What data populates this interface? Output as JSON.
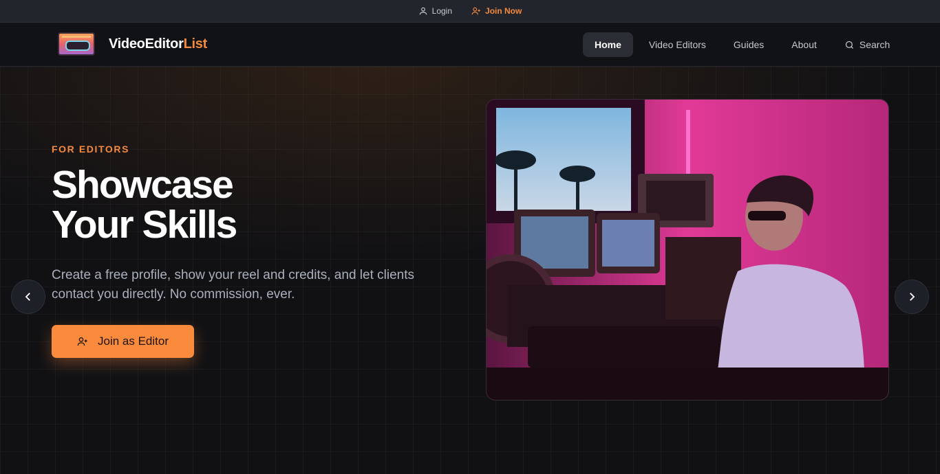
{
  "topbar": {
    "login": "Login",
    "join": "Join Now"
  },
  "brand": {
    "name_main": "VideoEditor",
    "name_accent": "List"
  },
  "nav": {
    "items": [
      "Home",
      "Video Editors",
      "Guides",
      "About"
    ],
    "search": "Search",
    "active": "Home"
  },
  "hero": {
    "eyebrow": "FOR EDITORS",
    "title_line1": "Showcase",
    "title_line2": "Your Skills",
    "lead": "Create a free profile, show your reel and credits, and let clients contact you directly. No commission, ever.",
    "cta": "Join as Editor"
  },
  "colors": {
    "accent": "#f58a3d",
    "background": "#111114",
    "button": "#fa8a3c"
  },
  "icons": [
    "user-icon",
    "user-plus-icon",
    "search-icon",
    "chevron-left-icon",
    "chevron-right-icon"
  ]
}
